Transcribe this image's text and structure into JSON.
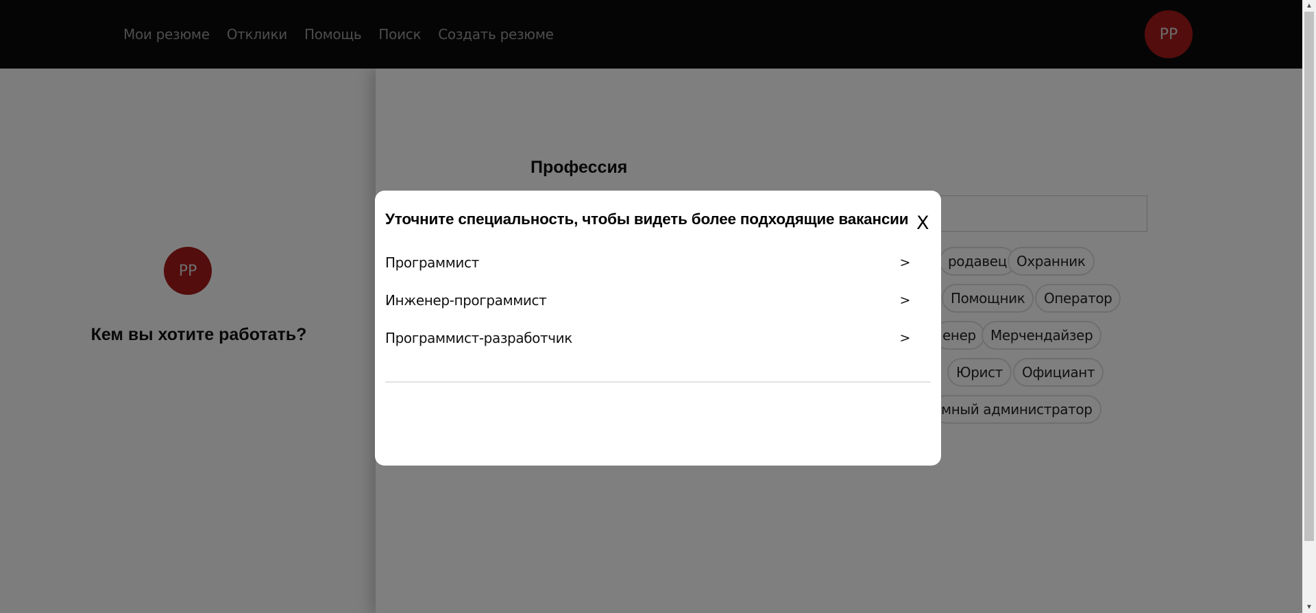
{
  "header": {
    "nav": [
      "Мои резюме",
      "Отклики",
      "Помощь",
      "Поиск",
      "Создать резюме"
    ],
    "avatar_initials": "РР"
  },
  "sidebar": {
    "avatar_initials": "РР",
    "question": "Кем вы хотите работать?"
  },
  "main": {
    "section_title": "Профессия",
    "search_value": "",
    "chips": [
      "родавец",
      "Охранник",
      "Помощник",
      "Оператор",
      "енер",
      "Мерчендайзер",
      "Юрист",
      "Официант",
      "мный администратор"
    ]
  },
  "modal": {
    "title": "Уточните специальность, чтобы видеть более подходящие вакансии",
    "close_label": "X",
    "items": [
      {
        "label": "Программист",
        "arrow": ">"
      },
      {
        "label": "Инженер-программист",
        "arrow": ">"
      },
      {
        "label": "Программист-разработчик",
        "arrow": ">"
      }
    ]
  },
  "scrollbar": {
    "up_arrow": "▲",
    "down_arrow": "▼"
  },
  "colors": {
    "header_bg": "#0b0b0b",
    "avatar_bg": "#a91b1b",
    "overlay": "rgba(0,0,0,0.5)",
    "modal_bg": "#ffffff"
  }
}
